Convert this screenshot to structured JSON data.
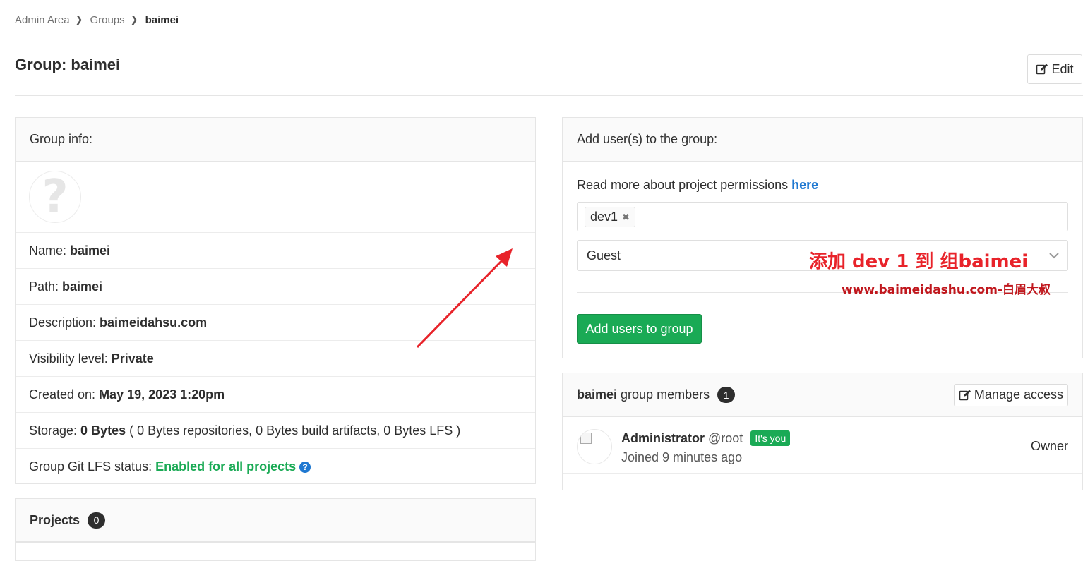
{
  "breadcrumb": {
    "items": [
      "Admin Area",
      "Groups"
    ],
    "current": "baimei"
  },
  "header": {
    "title": "Group: baimei",
    "edit_label": "Edit"
  },
  "group_info": {
    "header": "Group info:",
    "name_label": "Name:",
    "name_value": "baimei",
    "path_label": "Path:",
    "path_value": "baimei",
    "description_label": "Description:",
    "description_value": "baimeidahsu.com",
    "visibility_label": "Visibility level:",
    "visibility_value": "Private",
    "created_label": "Created on:",
    "created_value": "May 19, 2023 1:20pm",
    "storage_label": "Storage:",
    "storage_value": "0 Bytes",
    "storage_detail": "( 0 Bytes repositories, 0 Bytes build artifacts, 0 Bytes LFS )",
    "lfs_label": "Group Git LFS status:",
    "lfs_value": "Enabled for all projects"
  },
  "projects": {
    "title": "Projects",
    "count": "0"
  },
  "add_users": {
    "header": "Add user(s) to the group:",
    "perm_text": "Read more about project permissions",
    "perm_link": "here",
    "selected_user": "dev1",
    "role": "Guest",
    "submit_label": "Add users to group"
  },
  "members": {
    "group_name": "baimei",
    "title_suffix": "group members",
    "count": "1",
    "manage_label": "Manage access",
    "list": [
      {
        "name": "Administrator",
        "handle": "@root",
        "badge": "It's you",
        "joined": "Joined 9 minutes ago",
        "role": "Owner"
      }
    ]
  },
  "overlay": {
    "title": "添加 dev 1  到 组baimei",
    "subtitle": "www.baimeidashu.com-白眉大叔",
    "title_color": "#e8232a",
    "arrow_color": "#e8232a"
  },
  "colors": {
    "success": "#1aaa55",
    "link": "#1f78d1",
    "text": "#2e2e2e"
  }
}
